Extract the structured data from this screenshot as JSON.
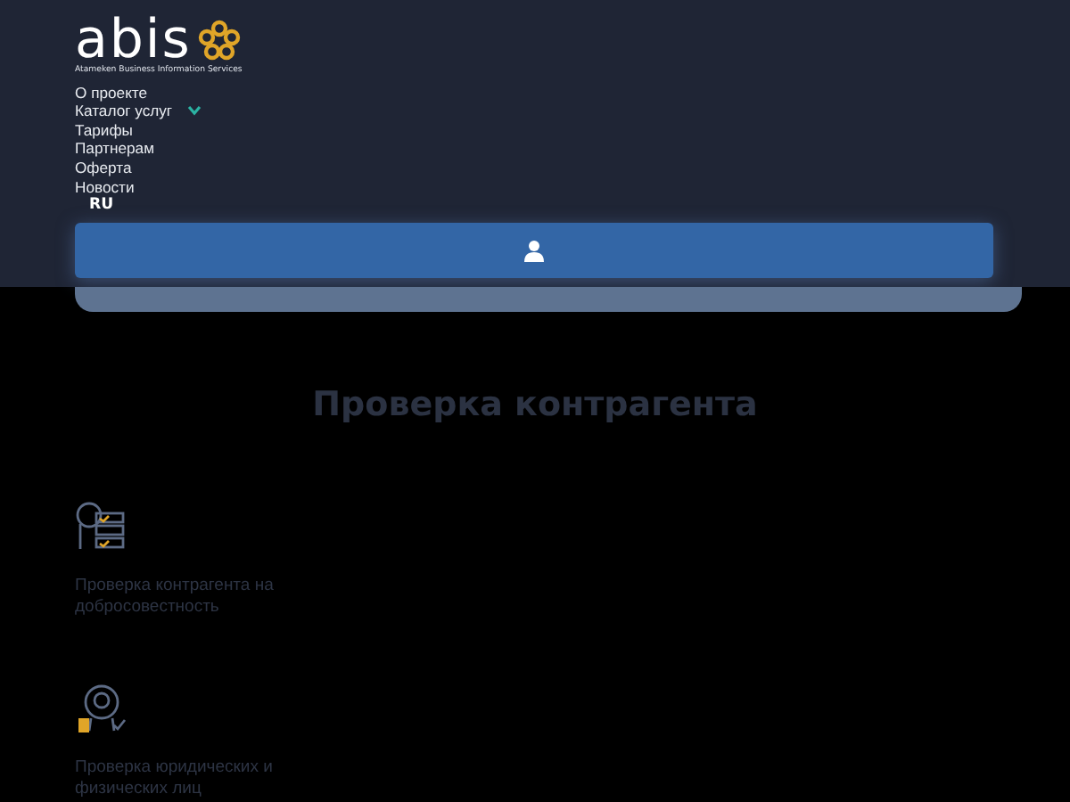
{
  "logo": {
    "wordmark": "abis",
    "tagline": "Atameken Business Information Services"
  },
  "nav": [
    {
      "label": "О проекте",
      "has_dropdown": false
    },
    {
      "label": "Каталог услуг",
      "has_dropdown": true
    },
    {
      "label": "Тарифы",
      "has_dropdown": false
    },
    {
      "label": "Партнерам",
      "has_dropdown": false
    },
    {
      "label": "Оферта",
      "has_dropdown": false
    },
    {
      "label": "Новости",
      "has_dropdown": false
    }
  ],
  "language": {
    "code": "RU",
    "selected": true
  },
  "page_title": "Проверка контрагента",
  "services": [
    {
      "kind": "checklist",
      "label": "Проверка контрагента на добросовестность"
    },
    {
      "kind": "award",
      "label": "Проверка юридических и физических лиц"
    }
  ]
}
